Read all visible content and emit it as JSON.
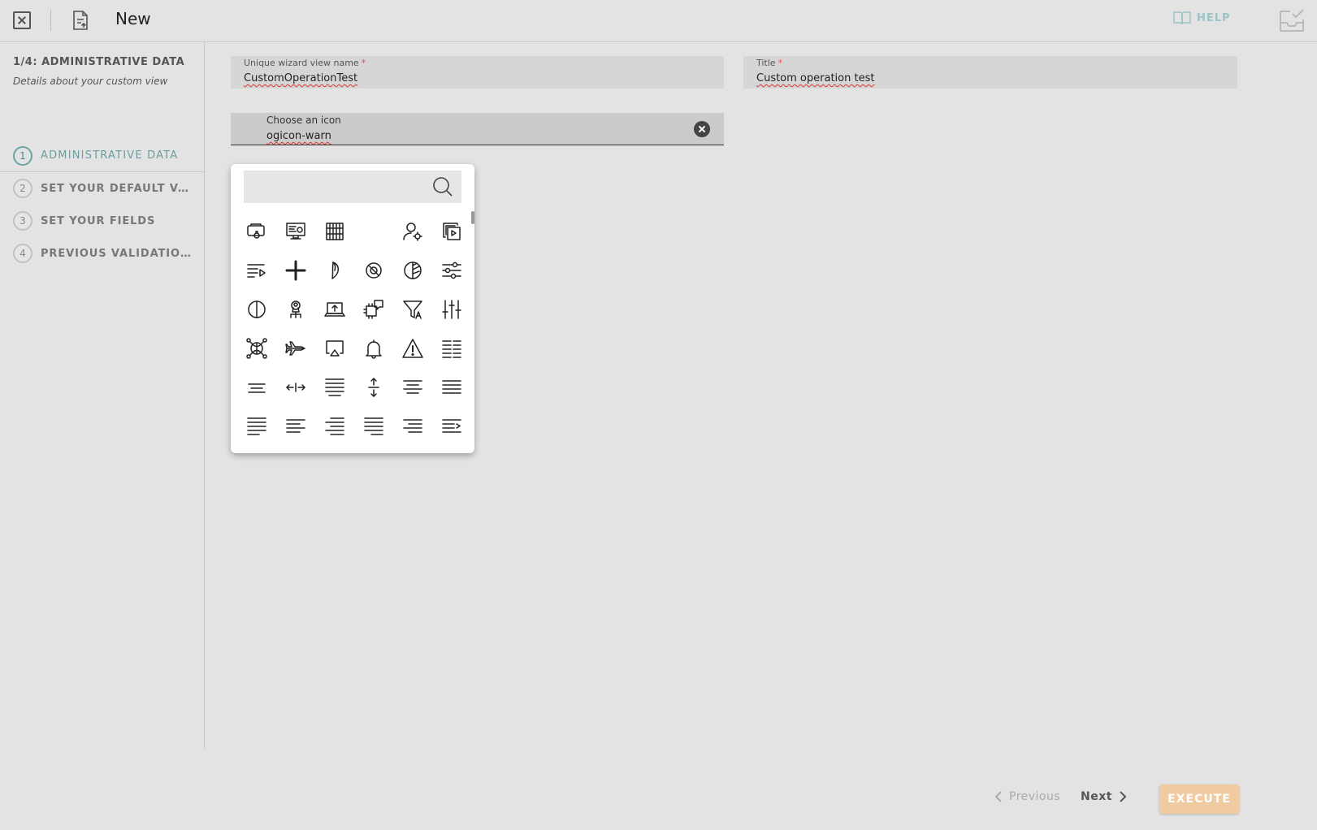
{
  "topbar": {
    "title": "New",
    "help_label": "HELP",
    "close_icon": "close-box-icon",
    "document_icon": "document-upload-icon",
    "help_icon": "book-question-icon",
    "inbox_icon": "inbox-check-icon"
  },
  "sidebar": {
    "heading": "1/4: ADMINISTRATIVE DATA",
    "subheading": "Details about your custom view",
    "steps": [
      {
        "number": "1",
        "label": "ADMINISTRATIVE DATA"
      },
      {
        "number": "2",
        "label": "SET YOUR DEFAULT VALUES"
      },
      {
        "number": "3",
        "label": "SET YOUR FIELDS"
      },
      {
        "number": "4",
        "label": "PREVIOUS VALIDATIONS"
      }
    ]
  },
  "form": {
    "name_label": "Unique wizard view name",
    "name_value": "CustomOperationTest",
    "title_label": "Title",
    "title_value": "Custom operation test",
    "required_mark": "*",
    "icon_label": "Choose an icon",
    "icon_value": "ogicon-warn"
  },
  "picker": {
    "search_value": "",
    "icons": [
      "camera-lock-icon",
      "monitor-chart-icon",
      "abacus-icon",
      "blank-icon",
      "user-gear-icon",
      "copy-play-icon",
      "list-play-icon",
      "plus-icon",
      "half-moon-icon",
      "ring-icon",
      "contrast-icon",
      "sliders-icon",
      "half-circle-icon",
      "network-person-icon",
      "laptop-upload-icon",
      "chip-chat-icon",
      "filter-text-icon",
      "equalizer-icon",
      "brain-network-icon",
      "airplane-icon",
      "airplay-icon",
      "bell-icon",
      "warning-icon",
      "align-justify-list-icon",
      "align-center-short-icon",
      "arrows-horizontal-icon",
      "align-justify-icon",
      "arrows-vertical-icon",
      "align-center-icon",
      "align-justify-all-icon",
      "align-left-icon",
      "align-left-short-icon",
      "align-right-icon",
      "align-justify-right-icon",
      "align-right-short-icon",
      "indent-right-icon"
    ]
  },
  "footer": {
    "previous_label": "Previous",
    "next_label": "Next",
    "execute_label": "EXECUTE",
    "execute_color": "#f0caa0",
    "accent_color": "#6b9ea2"
  }
}
